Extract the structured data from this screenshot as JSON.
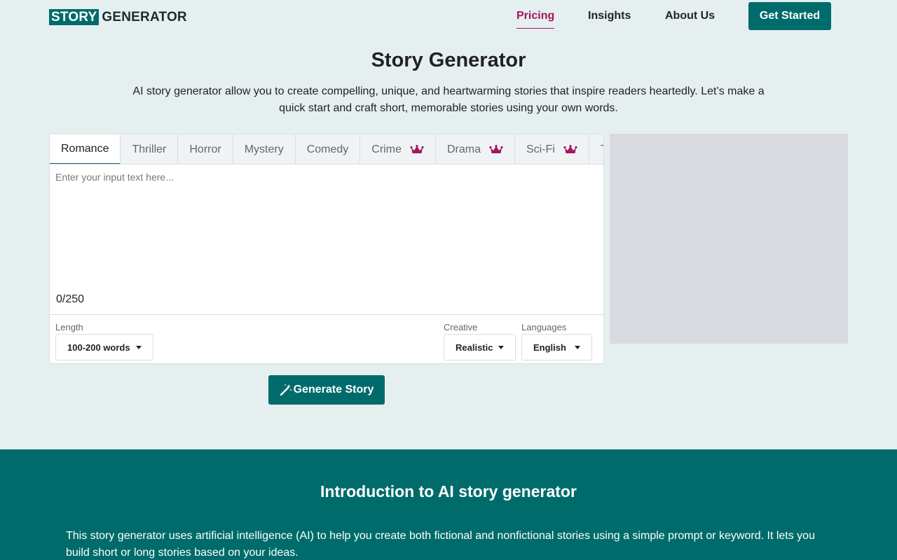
{
  "header": {
    "logo_box": "STORY",
    "logo_text": "GENERATOR",
    "nav": {
      "pricing": "Pricing",
      "insights": "Insights",
      "about": "About Us"
    },
    "cta": "Get Started",
    "active_link_color": "#a3155e"
  },
  "hero": {
    "title": "Story Generator",
    "subtitle": "AI story generator allow you to create compelling, unique, and heartwarming stories that inspire readers heartedly. Let’s make a quick start and craft short, memorable stories using your own words."
  },
  "generator": {
    "tabs": [
      {
        "label": "Romance",
        "premium": false,
        "active": true
      },
      {
        "label": "Thriller",
        "premium": false,
        "active": false
      },
      {
        "label": "Horror",
        "premium": false,
        "active": false
      },
      {
        "label": "Mystery",
        "premium": false,
        "active": false
      },
      {
        "label": "Comedy",
        "premium": false,
        "active": false
      },
      {
        "label": "Crime",
        "premium": true,
        "active": false
      },
      {
        "label": "Drama",
        "premium": true,
        "active": false
      },
      {
        "label": "Sci-Fi",
        "premium": true,
        "active": false
      },
      {
        "label": "T",
        "premium": false,
        "active": false
      }
    ],
    "input_placeholder": "Enter your input text here...",
    "input_value": "",
    "counter": "0/250",
    "length": {
      "label": "Length",
      "value": "100-200 words"
    },
    "creative": {
      "label": "Creative",
      "value": "Realistic"
    },
    "languages": {
      "label": "Languages",
      "value": "English"
    },
    "generate_label": "Generate Story",
    "generate_icon": "magic-wand-icon"
  },
  "intro": {
    "title": "Introduction to AI story generator",
    "text": "This story generator uses artificial intelligence (AI) to help you create both fictional and nonfictional stories using a simple prompt or keyword. It lets you build short or long stories based on your ideas."
  },
  "colors": {
    "brand": "#006b6b",
    "accent": "#a3155e",
    "background": "#e6eff0"
  }
}
